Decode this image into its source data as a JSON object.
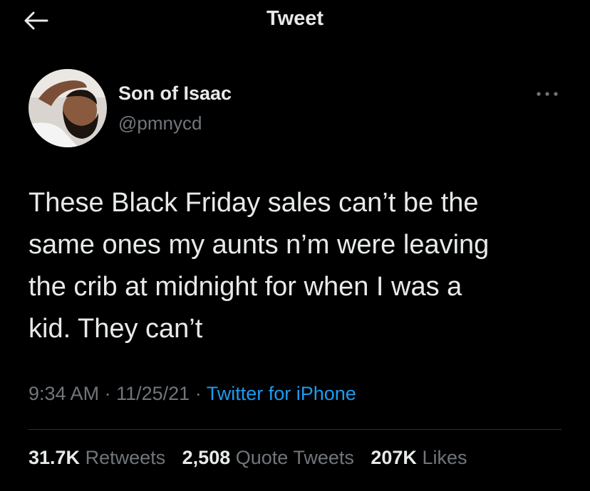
{
  "header": {
    "title": "Tweet",
    "back_icon": "arrow-left-icon"
  },
  "author": {
    "display_name": "Son of Isaac",
    "handle": "@pmnycd",
    "avatar_icon": "profile-photo-avatar"
  },
  "more_icon": "more-dots-icon",
  "tweet": {
    "text": "These Black Friday sales can’t be the\nsame ones my aunts n’m were leaving\nthe crib at midnight for when I was a\nkid. They can’t",
    "time": "9:34 AM",
    "separator": "·",
    "date": "11/25/21",
    "source": "Twitter for iPhone"
  },
  "stats": {
    "retweets_count": "31.7K",
    "retweets_label": "Retweets",
    "quotes_count": "2,508",
    "quotes_label": "Quote Tweets",
    "likes_count": "207K",
    "likes_label": "Likes"
  },
  "colors": {
    "background": "#000000",
    "primary_text": "#e7e9ea",
    "secondary_text": "#71767b",
    "link": "#1d9bf0",
    "divider": "#2f3336"
  }
}
